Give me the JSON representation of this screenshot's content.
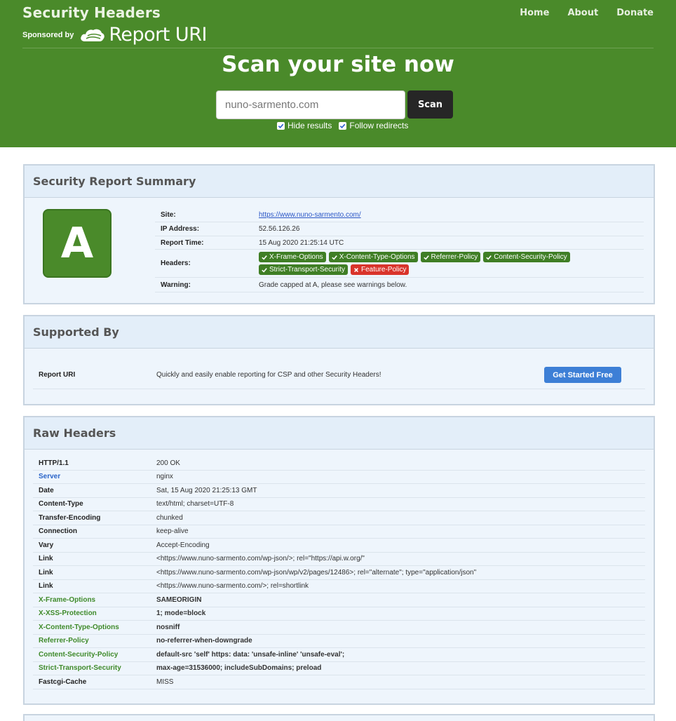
{
  "header": {
    "brand_title": "Security Headers",
    "sponsored_by": "Sponsored by",
    "sponsor_name": "Report URI",
    "nav": [
      "Home",
      "About",
      "Donate"
    ],
    "scan_title": "Scan your site now",
    "scan_input_value": "nuno-sarmento.com",
    "scan_button": "Scan",
    "opt_hide": "Hide results",
    "opt_follow": "Follow redirects"
  },
  "summary": {
    "heading": "Security Report Summary",
    "grade": "A",
    "rows": {
      "site_label": "Site:",
      "site_value": "https://www.nuno-sarmento.com/",
      "ip_label": "IP Address:",
      "ip_value": "52.56.126.26",
      "time_label": "Report Time:",
      "time_value": "15 Aug 2020 21:25:14 UTC",
      "headers_label": "Headers:",
      "warning_label": "Warning:",
      "warning_value": "Grade capped at A, please see warnings below."
    },
    "tags": [
      {
        "label": "X-Frame-Options",
        "status": "ok"
      },
      {
        "label": "X-Content-Type-Options",
        "status": "ok"
      },
      {
        "label": "Referrer-Policy",
        "status": "ok"
      },
      {
        "label": "Content-Security-Policy",
        "status": "ok"
      },
      {
        "label": "Strict-Transport-Security",
        "status": "ok"
      },
      {
        "label": "Feature-Policy",
        "status": "missing"
      }
    ]
  },
  "supported": {
    "heading": "Supported By",
    "name": "Report URI",
    "description": "Quickly and easily enable reporting for CSP and other Security Headers!",
    "cta": "Get Started Free"
  },
  "raw": {
    "heading": "Raw Headers",
    "rows": [
      {
        "key": "HTTP/1.1",
        "value": "200 OK",
        "style": "plain",
        "bold": false
      },
      {
        "key": "Server",
        "value": "nginx",
        "style": "blue",
        "bold": false
      },
      {
        "key": "Date",
        "value": "Sat, 15 Aug 2020 21:25:13 GMT",
        "style": "plain",
        "bold": false
      },
      {
        "key": "Content-Type",
        "value": "text/html; charset=UTF-8",
        "style": "plain",
        "bold": false
      },
      {
        "key": "Transfer-Encoding",
        "value": "chunked",
        "style": "plain",
        "bold": false
      },
      {
        "key": "Connection",
        "value": "keep-alive",
        "style": "plain",
        "bold": false
      },
      {
        "key": "Vary",
        "value": "Accept-Encoding",
        "style": "plain",
        "bold": false
      },
      {
        "key": "Link",
        "value": "<https://www.nuno-sarmento.com/wp-json/>; rel=\"https://api.w.org/\"",
        "style": "plain",
        "bold": false
      },
      {
        "key": "Link",
        "value": "<https://www.nuno-sarmento.com/wp-json/wp/v2/pages/12486>; rel=\"alternate\"; type=\"application/json\"",
        "style": "plain",
        "bold": false
      },
      {
        "key": "Link",
        "value": "<https://www.nuno-sarmento.com/>; rel=shortlink",
        "style": "plain",
        "bold": false
      },
      {
        "key": "X-Frame-Options",
        "value": "SAMEORIGIN",
        "style": "green",
        "bold": true
      },
      {
        "key": "X-XSS-Protection",
        "value": "1; mode=block",
        "style": "green",
        "bold": true
      },
      {
        "key": "X-Content-Type-Options",
        "value": "nosniff",
        "style": "green",
        "bold": true
      },
      {
        "key": "Referrer-Policy",
        "value": "no-referrer-when-downgrade",
        "style": "green",
        "bold": true
      },
      {
        "key": "Content-Security-Policy",
        "value": "default-src 'self' https: data: 'unsafe-inline' 'unsafe-eval';",
        "style": "green",
        "bold": true
      },
      {
        "key": "Strict-Transport-Security",
        "value": "max-age=31536000; includeSubDomains; preload",
        "style": "green",
        "bold": true
      },
      {
        "key": "Fastcgi-Cache",
        "value": "MISS",
        "style": "plain",
        "bold": false
      }
    ]
  }
}
